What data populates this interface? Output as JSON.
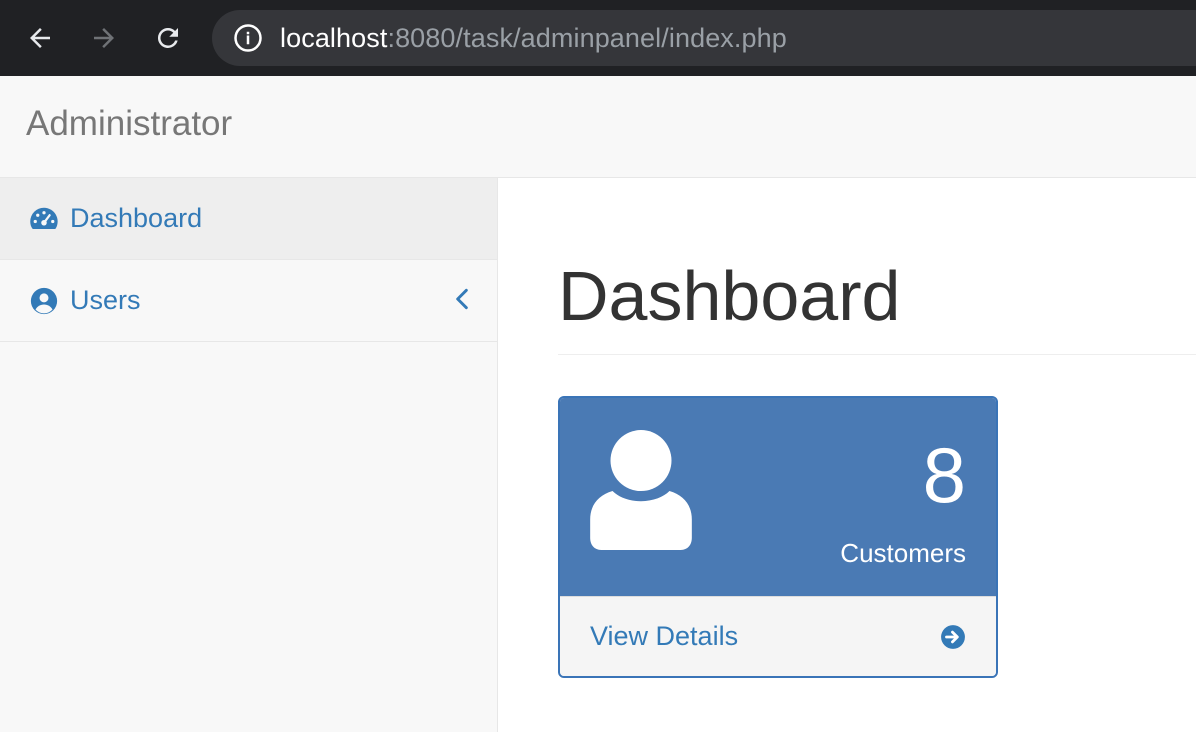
{
  "browser": {
    "url_host": "localhost",
    "url_rest": ":8080/task/adminpanel/index.php"
  },
  "navbar": {
    "brand": "Administrator"
  },
  "sidebar": {
    "items": [
      {
        "label": "Dashboard",
        "icon": "dashboard-icon",
        "active": true
      },
      {
        "label": "Users",
        "icon": "user-circle-icon",
        "expandable": true
      }
    ]
  },
  "main": {
    "title": "Dashboard",
    "panel": {
      "count": "8",
      "label": "Customers",
      "footer_label": "View Details",
      "icon": "user-icon"
    }
  },
  "colors": {
    "link": "#337ab7",
    "panel_primary": "#4a7ab4",
    "chrome_bg": "#202124"
  }
}
